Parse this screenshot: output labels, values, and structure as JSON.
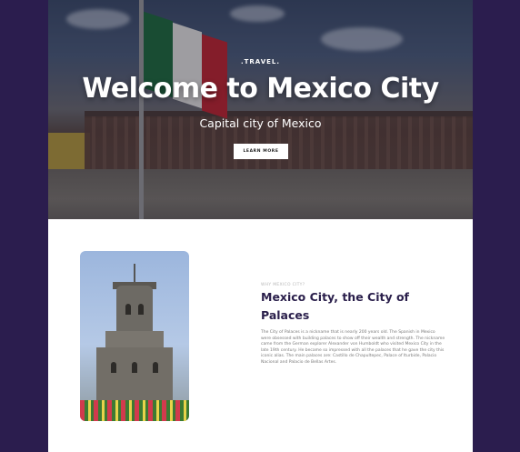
{
  "hero": {
    "kicker": ".TRAVEL.",
    "title": "Welcome to Mexico City",
    "subtitle": "Capital city of Mexico",
    "button_label": "LEARN MORE"
  },
  "about": {
    "eyebrow": "WHY MEXICO CITY?",
    "title": "Mexico City, the City of Palaces",
    "body": "The City of Palaces is a nickname that is nearly 200 years old. The Spanish in Mexico were obsessed with building palaces to show off their wealth and strength. The nickname came from the German explorer Alexander von Humboldt who visited Mexico City in the late 19th century. He became so impressed with all the palaces that he gave the city this iconic alias. The main palaces are: Castillo de Chapultepec, Palace of Iturbide, Palacio Nacional and Palacio de Bellas Artes."
  },
  "colors": {
    "background": "#2b1d4e",
    "title": "#2a1f4b",
    "body_text": "#7a7a7a"
  }
}
